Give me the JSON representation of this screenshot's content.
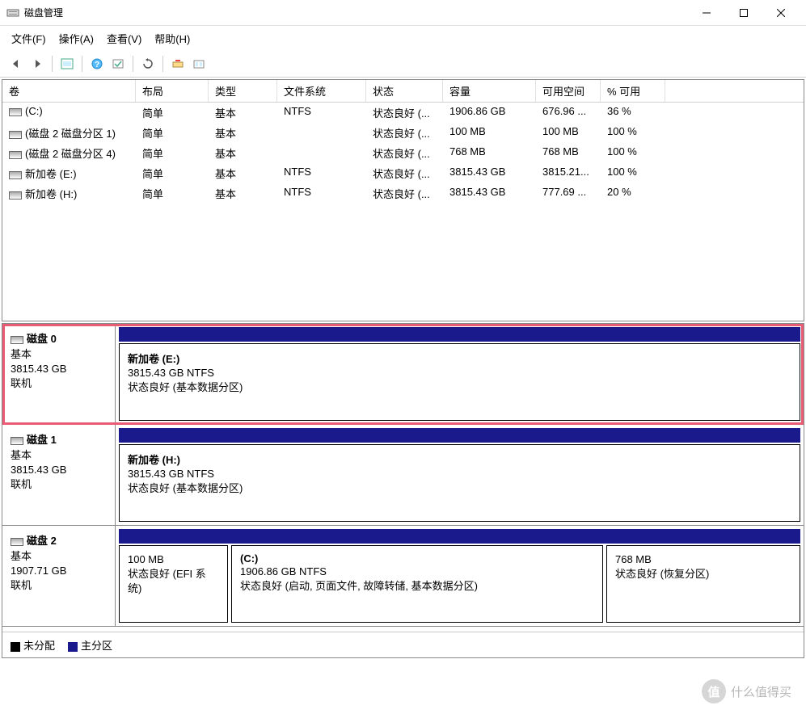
{
  "window": {
    "title": "磁盘管理"
  },
  "menu": {
    "file": "文件(F)",
    "action": "操作(A)",
    "view": "查看(V)",
    "help": "帮助(H)"
  },
  "columns": {
    "volume": "卷",
    "layout": "布局",
    "type": "类型",
    "filesystem": "文件系统",
    "status": "状态",
    "capacity": "容量",
    "free": "可用空间",
    "pct": "% 可用"
  },
  "volumes": [
    {
      "name": "(C:)",
      "layout": "简单",
      "type": "基本",
      "fs": "NTFS",
      "status": "状态良好 (...",
      "cap": "1906.86 GB",
      "free": "676.96 ...",
      "pct": "36 %"
    },
    {
      "name": "(磁盘 2 磁盘分区 1)",
      "layout": "简单",
      "type": "基本",
      "fs": "",
      "status": "状态良好 (...",
      "cap": "100 MB",
      "free": "100 MB",
      "pct": "100 %"
    },
    {
      "name": "(磁盘 2 磁盘分区 4)",
      "layout": "简单",
      "type": "基本",
      "fs": "",
      "status": "状态良好 (...",
      "cap": "768 MB",
      "free": "768 MB",
      "pct": "100 %"
    },
    {
      "name": "新加卷 (E:)",
      "layout": "简单",
      "type": "基本",
      "fs": "NTFS",
      "status": "状态良好 (...",
      "cap": "3815.43 GB",
      "free": "3815.21...",
      "pct": "100 %"
    },
    {
      "name": "新加卷 (H:)",
      "layout": "简单",
      "type": "基本",
      "fs": "NTFS",
      "status": "状态良好 (...",
      "cap": "3815.43 GB",
      "free": "777.69 ...",
      "pct": "20 %"
    }
  ],
  "disks": [
    {
      "title": "磁盘 0",
      "type": "基本",
      "size": "3815.43 GB",
      "state": "联机",
      "partitions": [
        {
          "name": "新加卷 (E:)",
          "size": "3815.43 GB NTFS",
          "status": "状态良好 (基本数据分区)",
          "cls": "wide"
        }
      ],
      "highlighted": true
    },
    {
      "title": "磁盘 1",
      "type": "基本",
      "size": "3815.43 GB",
      "state": "联机",
      "partitions": [
        {
          "name": "新加卷 (H:)",
          "size": "3815.43 GB NTFS",
          "status": "状态良好 (基本数据分区)",
          "cls": "wide"
        }
      ],
      "highlighted": false
    },
    {
      "title": "磁盘 2",
      "type": "基本",
      "size": "1907.71 GB",
      "state": "联机",
      "partitions": [
        {
          "name": "",
          "size": "100 MB",
          "status": "状态良好 (EFI 系统)",
          "cls": "small"
        },
        {
          "name": "(C:)",
          "size": "1906.86 GB NTFS",
          "status": "状态良好 (启动, 页面文件, 故障转储, 基本数据分区)",
          "cls": "wide"
        },
        {
          "name": "",
          "size": "768 MB",
          "status": "状态良好 (恢复分区)",
          "cls": "recovery"
        }
      ],
      "highlighted": false
    }
  ],
  "legend": {
    "unallocated": "未分配",
    "primary": "主分区"
  },
  "watermark": {
    "badge": "值",
    "text": "什么值得买"
  }
}
